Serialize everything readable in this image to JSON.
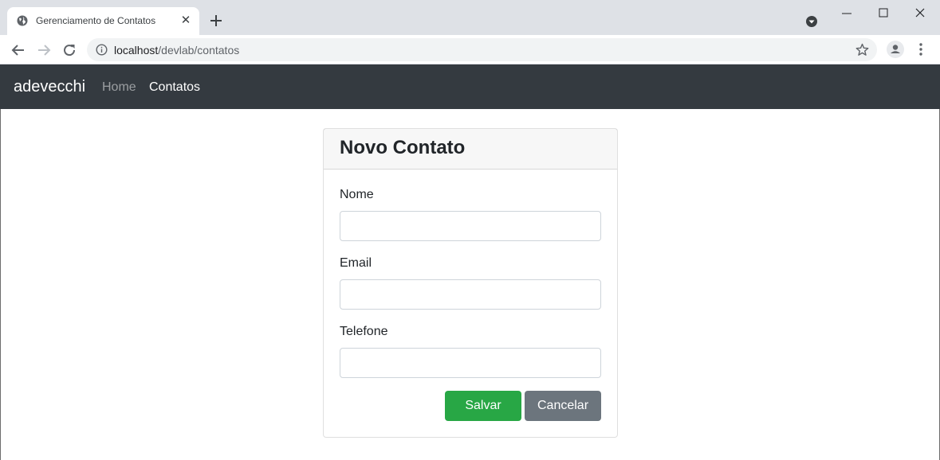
{
  "browser": {
    "tab": {
      "title": "Gerenciamento de Contatos",
      "favicon": "globe-icon",
      "close_glyph": "✕"
    },
    "new_tab_icon": "plus-icon",
    "address": {
      "host": "localhost",
      "path": "/devlab/contatos"
    }
  },
  "navbar": {
    "brand": "adevecchi",
    "links": [
      {
        "label": "Home"
      },
      {
        "label": "Contatos"
      }
    ]
  },
  "form": {
    "title": "Novo Contato",
    "fields": [
      {
        "label": "Nome",
        "value": ""
      },
      {
        "label": "Email",
        "value": ""
      },
      {
        "label": "Telefone",
        "value": ""
      }
    ],
    "buttons": {
      "save": "Salvar",
      "cancel": "Cancelar"
    }
  },
  "colors": {
    "navbar_bg": "#343a40",
    "save_button": "#28a745",
    "cancel_button": "#6c757d"
  }
}
